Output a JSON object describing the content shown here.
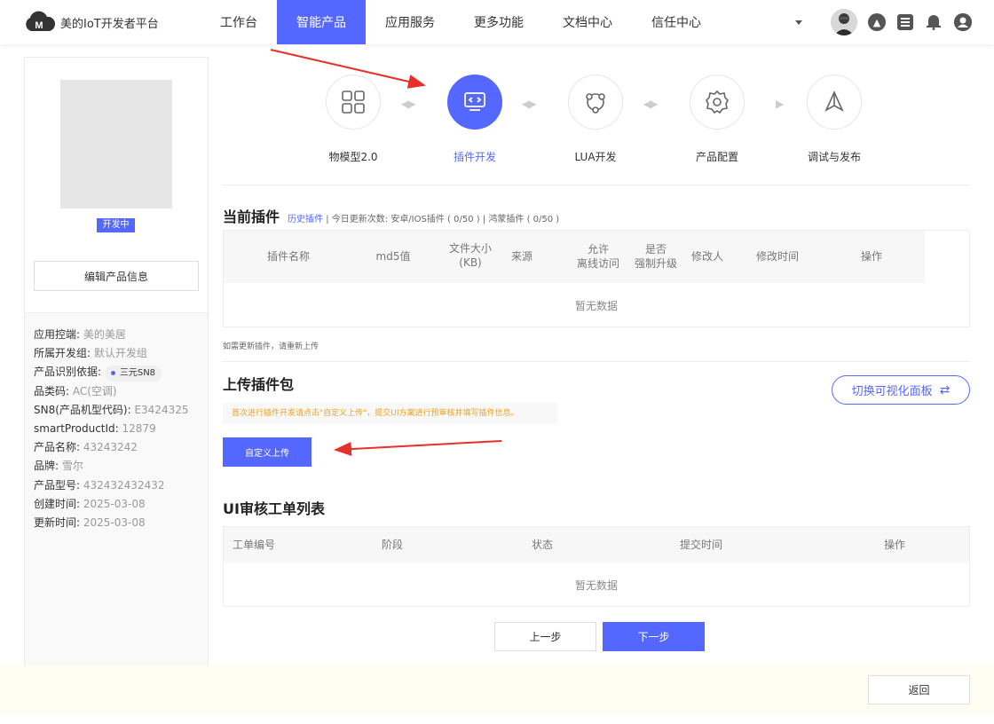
{
  "header": {
    "brand": "美的IoT开发者平台",
    "nav": [
      {
        "label": "工作台"
      },
      {
        "label": "智能产品",
        "active": true
      },
      {
        "label": "应用服务"
      },
      {
        "label": "更多功能"
      },
      {
        "label": "文档中心"
      },
      {
        "label": "信任中心"
      }
    ],
    "accent": "#5468ff"
  },
  "product": {
    "status_badge": "开发中",
    "edit_button": "编辑产品信息",
    "info": [
      {
        "label": "应用控端: ",
        "value": "美的美居"
      },
      {
        "label": "所属开发组: ",
        "value": "默认开发组"
      },
      {
        "label": "产品识别依据: ",
        "chip": "三元SN8"
      },
      {
        "label": "品类码: ",
        "value": "AC(空调)"
      },
      {
        "label": "SN8(产品机型代码): ",
        "value": "E3424325"
      },
      {
        "label": "smartProductId: ",
        "value": "12879"
      },
      {
        "label": "产品名称: ",
        "value": "43243242"
      },
      {
        "label": "品牌: ",
        "value": "雪尔"
      },
      {
        "label": "产品型号: ",
        "value": "432432432432"
      },
      {
        "label": "创建时间: ",
        "value": "2025-03-08"
      },
      {
        "label": "更新时间: ",
        "value": "2025-03-08"
      }
    ]
  },
  "steps": [
    {
      "label": "物模型2.0",
      "icon": "grid-icon"
    },
    {
      "label": "插件开发",
      "icon": "code-screen-icon",
      "active": true
    },
    {
      "label": "LUA开发",
      "icon": "network-icon"
    },
    {
      "label": "产品配置",
      "icon": "gear-icon"
    },
    {
      "label": "调试与发布",
      "icon": "send-icon"
    }
  ],
  "current_plugins": {
    "title": "当前插件",
    "history_link": "历史插件",
    "sep1": "|",
    "update_count": "今日更新次数:",
    "android_ios": "安卓/IOS插件 ( 0/50 )",
    "sep2": "|",
    "harmony": "鸿蒙插件 ( 0/50 )",
    "columns": [
      "插件名称",
      "md5值",
      "文件大小\n(KB)",
      "来源",
      "允许\n离线访问",
      "是否\n强制升级",
      "修改人",
      "修改时间",
      "操作"
    ],
    "empty": "暂无数据",
    "note": "如需更新插件，请重新上传"
  },
  "upload": {
    "title": "上传插件包",
    "tip": "首次进行插件开发请点击\"自定义上传\"，提交UI方案进行预审核并填写插件信息。",
    "button": "自定义上传",
    "switch_button": "切换可视化面板"
  },
  "ui_review": {
    "title": "UI审核工单列表",
    "columns": [
      "工单编号",
      "阶段",
      "状态",
      "提交时间",
      "操作"
    ],
    "empty": "暂无数据"
  },
  "pager": {
    "prev": "上一步",
    "next": "下一步"
  },
  "footer": {
    "back": "返回"
  }
}
